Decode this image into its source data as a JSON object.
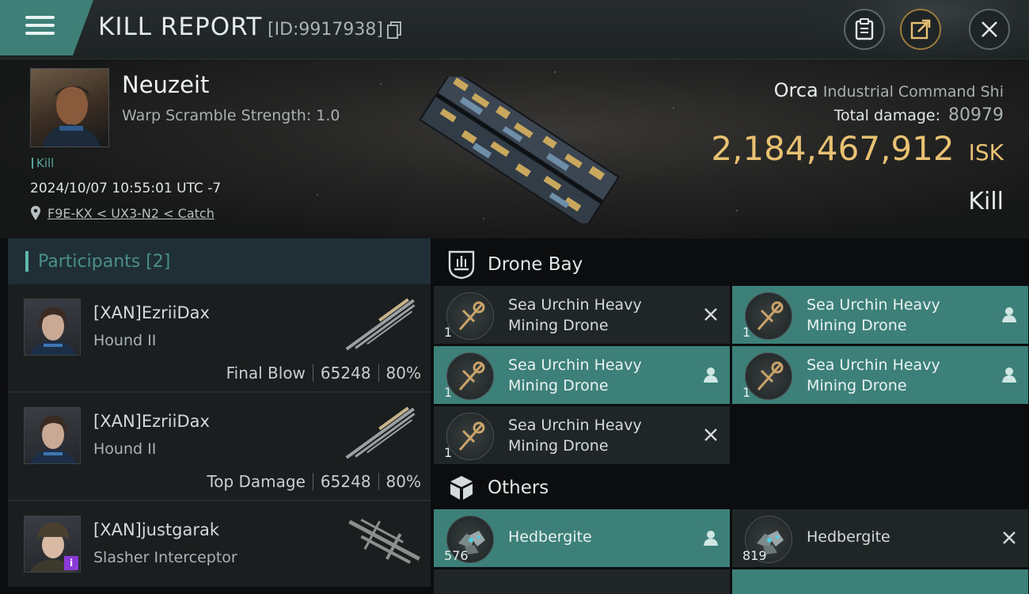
{
  "header": {
    "title": "KILL REPORT",
    "report_id": "[ID:9917938]",
    "menu_icon": "hamburger-icon",
    "buttons": [
      "clipboard-icon",
      "share-icon",
      "close-icon"
    ]
  },
  "victim": {
    "name": "Neuzeit",
    "detail": "Warp Scramble Strength: 1.0",
    "status_tag": "Kill",
    "timestamp": "2024/10/07 10:55:01 UTC -7",
    "location": "F9E-KX < UX3-N2 < Catch",
    "ship_name": "Orca",
    "ship_class": "Industrial Command Shi",
    "total_damage_label": "Total damage:",
    "total_damage": "80979",
    "isk_value": "2,184,467,912",
    "isk_unit": "ISK",
    "result": "Kill"
  },
  "participants": {
    "title": "Participants [2]",
    "rows": [
      {
        "name": "[XAN]EzriiDax",
        "ship": "Hound II",
        "role": "Final Blow",
        "damage": "65248",
        "percent": "80%"
      },
      {
        "name": "[XAN]EzriiDax",
        "ship": "Hound II",
        "role": "Top Damage",
        "damage": "65248",
        "percent": "80%"
      },
      {
        "name": "[XAN]justgarak",
        "ship": "Slasher Interceptor",
        "role": "",
        "damage": "",
        "percent": "",
        "badge": "i"
      }
    ]
  },
  "drone_bay": {
    "title": "Drone Bay",
    "items": [
      {
        "name_line1": "Sea Urchin Heavy",
        "name_line2": "Mining Drone",
        "qty": "1",
        "status": "destroyed",
        "action_icon": "close-icon"
      },
      {
        "name_line1": "Sea Urchin Heavy",
        "name_line2": "Mining Drone",
        "qty": "1",
        "status": "dropped",
        "action_icon": "person-icon"
      },
      {
        "name_line1": "Sea Urchin Heavy",
        "name_line2": "Mining Drone",
        "qty": "1",
        "status": "dropped",
        "action_icon": "person-icon"
      },
      {
        "name_line1": "Sea Urchin Heavy",
        "name_line2": "Mining Drone",
        "qty": "1",
        "status": "dropped",
        "action_icon": "person-icon"
      },
      {
        "name_line1": "Sea Urchin Heavy",
        "name_line2": "Mining Drone",
        "qty": "1",
        "status": "destroyed",
        "action_icon": "close-icon"
      }
    ]
  },
  "others": {
    "title": "Others",
    "items": [
      {
        "name": "Hedbergite",
        "qty": "576",
        "status": "dropped",
        "action_icon": "person-icon"
      },
      {
        "name": "Hedbergite",
        "qty": "819",
        "status": "destroyed",
        "action_icon": "close-icon"
      }
    ]
  },
  "colors": {
    "accent_teal": "#3d7f79",
    "isk_gold": "#e9c172",
    "background": "#181c1d"
  }
}
